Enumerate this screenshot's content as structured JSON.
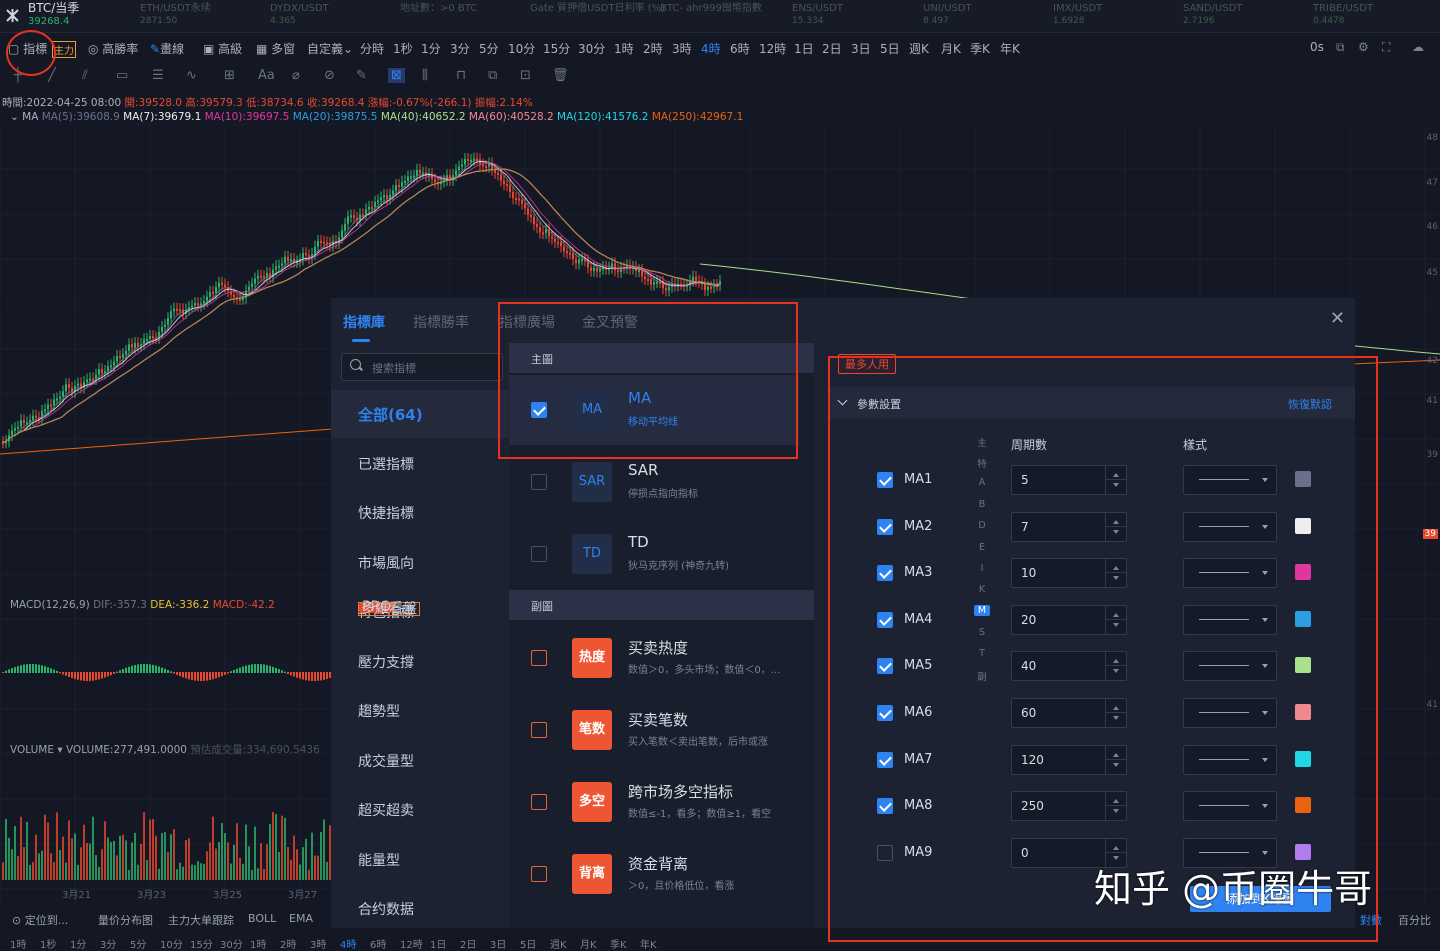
{
  "ticker": {
    "symbol": "BTC/当季",
    "price": "39268.4",
    "items": [
      {
        "name": "ETH/USDT永续",
        "value": "2871.50"
      },
      {
        "name": "DYDX/USDT",
        "value": "4.365"
      },
      {
        "name": "地址數：>0 BTC",
        "value": ""
      },
      {
        "name": "Gate 質押借USDT日利率 (%)",
        "value": ""
      },
      {
        "name": "BTC- ahr999囤幣指數",
        "value": ""
      },
      {
        "name": "ENS/USDT",
        "value": "15.334"
      },
      {
        "name": "UNI/USDT",
        "value": "8.497"
      },
      {
        "name": "IMX/USDT",
        "value": "1.6928"
      },
      {
        "name": "SAND/USDT",
        "value": "2.7196"
      },
      {
        "name": "TRIBE/USDT",
        "value": "0.4478"
      }
    ]
  },
  "toolbar": {
    "indicators": "指標",
    "main_force": "主力",
    "high_win": "高勝率",
    "draw_line": "畫線",
    "advanced": "高級",
    "multi_window": "多窗",
    "custom": "自定義",
    "timeframes": [
      "分時",
      "1秒",
      "1分",
      "3分",
      "5分",
      "10分",
      "15分",
      "30分",
      "1時",
      "2時",
      "3時",
      "4時",
      "6時",
      "12時",
      "1日",
      "2日",
      "3日",
      "5日",
      "週K",
      "月K",
      "季K",
      "年K"
    ],
    "active_timeframe": "4時",
    "right": "0s"
  },
  "drawing_tools": [
    "Aa"
  ],
  "ohlc": {
    "time": "時間:2022-04-25 08:00",
    "open": "開:39528.0",
    "high": "高:39579.3",
    "low": "低:38734.6",
    "close": "收:39268.4",
    "change": "漲幅:-0.67%(-266.1)",
    "amp": "振幅:2.14%"
  },
  "ma_line": {
    "name": "MA",
    "items": [
      "MA(5):39608.9",
      "MA(7):39679.1",
      "MA(10):39697.5",
      "MA(20):39875.5",
      "MA(40):40652.2",
      "MA(60):40528.2",
      "MA(120):41576.2",
      "MA(250):42967.1"
    ]
  },
  "macd": {
    "label": "MACD(12,26,9)",
    "dif": "DIF:-357.3",
    "dea": "DEA:-336.2",
    "macd": "MACD:-42.2"
  },
  "volume": {
    "label": "VOLUME",
    "value": "VOLUME:277,491.0000",
    "pred": "預估成交量:334,690.5436"
  },
  "x_dates": [
    "3月21",
    "3月23",
    "3月25",
    "3月27"
  ],
  "y_axis": [
    "48",
    "47",
    "46",
    "45",
    "42",
    "41",
    "39",
    "41"
  ],
  "y_axis_current": "39",
  "bottom_tools": [
    "定位到...",
    "量价分布图",
    "主力大单跟踪",
    "BOLL",
    "EMA"
  ],
  "bottom_timeframes": [
    "1時",
    "1秒",
    "1分",
    "3分",
    "5分",
    "10分",
    "15分",
    "30分",
    "1時",
    "2時",
    "3時",
    "4時",
    "6時",
    "12時",
    "1日",
    "2日",
    "3日",
    "5日",
    "週K",
    "月K",
    "季K",
    "年K"
  ],
  "bottom_right": {
    "log": "對數",
    "pct": "百分比"
  },
  "modal": {
    "tabs": [
      "指標庫",
      "指標勝率",
      "指標廣場",
      "金叉預警"
    ],
    "search_placeholder": "搜索指標",
    "categories": [
      "全部(64)",
      "已選指標",
      "快捷指標",
      "市場風向",
      "特色指標",
      "壓力支撐",
      "趨勢型",
      "成交量型",
      "超买超卖",
      "能量型",
      "合约数据"
    ],
    "pro": "PRO",
    "multi_view": "多維看盤",
    "section_main": "主圖",
    "section_sub": "副圖",
    "main_indicators": [
      {
        "icon": "MA",
        "name": "MA",
        "desc": "移动平均线",
        "checked": true
      },
      {
        "icon": "SAR",
        "name": "SAR",
        "desc": "停损点指向指标",
        "checked": false
      },
      {
        "icon": "TD",
        "name": "TD",
        "desc": "狄马克序列 (神奇九转)",
        "checked": false
      }
    ],
    "sub_indicators": [
      {
        "icon": "热度",
        "name": "买卖热度",
        "desc": "数值＞0，多头市场；数值＜0，..."
      },
      {
        "icon": "笔数",
        "name": "买卖笔数",
        "desc": "买入笔数＜卖出笔数，后市或涨"
      },
      {
        "icon": "多空",
        "name": "跨市场多空指标",
        "desc": "数值≤-1，看多；数值≥1，看空"
      },
      {
        "icon": "背离",
        "name": "资金背离",
        "desc": "＞0，且价格低位，看涨"
      }
    ],
    "alpha": [
      "主",
      "特",
      "A",
      "B",
      "D",
      "E",
      "I",
      "K",
      "M",
      "S",
      "T",
      "副"
    ],
    "alpha_selected": "M",
    "badge": "最多人用",
    "param_title": "參數設置",
    "restore": "恢復默認",
    "col_period": "周期數",
    "col_style": "樣式",
    "ma_rows": [
      {
        "name": "MA1",
        "period": "5",
        "checked": true,
        "color": "#6b6f8c"
      },
      {
        "name": "MA2",
        "period": "7",
        "checked": true,
        "color": "#eeeeee"
      },
      {
        "name": "MA3",
        "period": "10",
        "checked": true,
        "color": "#e0379e"
      },
      {
        "name": "MA4",
        "period": "20",
        "checked": true,
        "color": "#2c9fe0"
      },
      {
        "name": "MA5",
        "period": "40",
        "checked": true,
        "color": "#a9e08a"
      },
      {
        "name": "MA6",
        "period": "60",
        "checked": true,
        "color": "#f08a90"
      },
      {
        "name": "MA7",
        "period": "120",
        "checked": true,
        "color": "#1fd8e6"
      },
      {
        "name": "MA8",
        "period": "250",
        "checked": true,
        "color": "#e8620f"
      },
      {
        "name": "MA9",
        "period": "0",
        "checked": false,
        "color": "#b07cf0"
      }
    ],
    "add_button": "添加到K線圖"
  },
  "watermark": "知乎 @币圈牛哥"
}
